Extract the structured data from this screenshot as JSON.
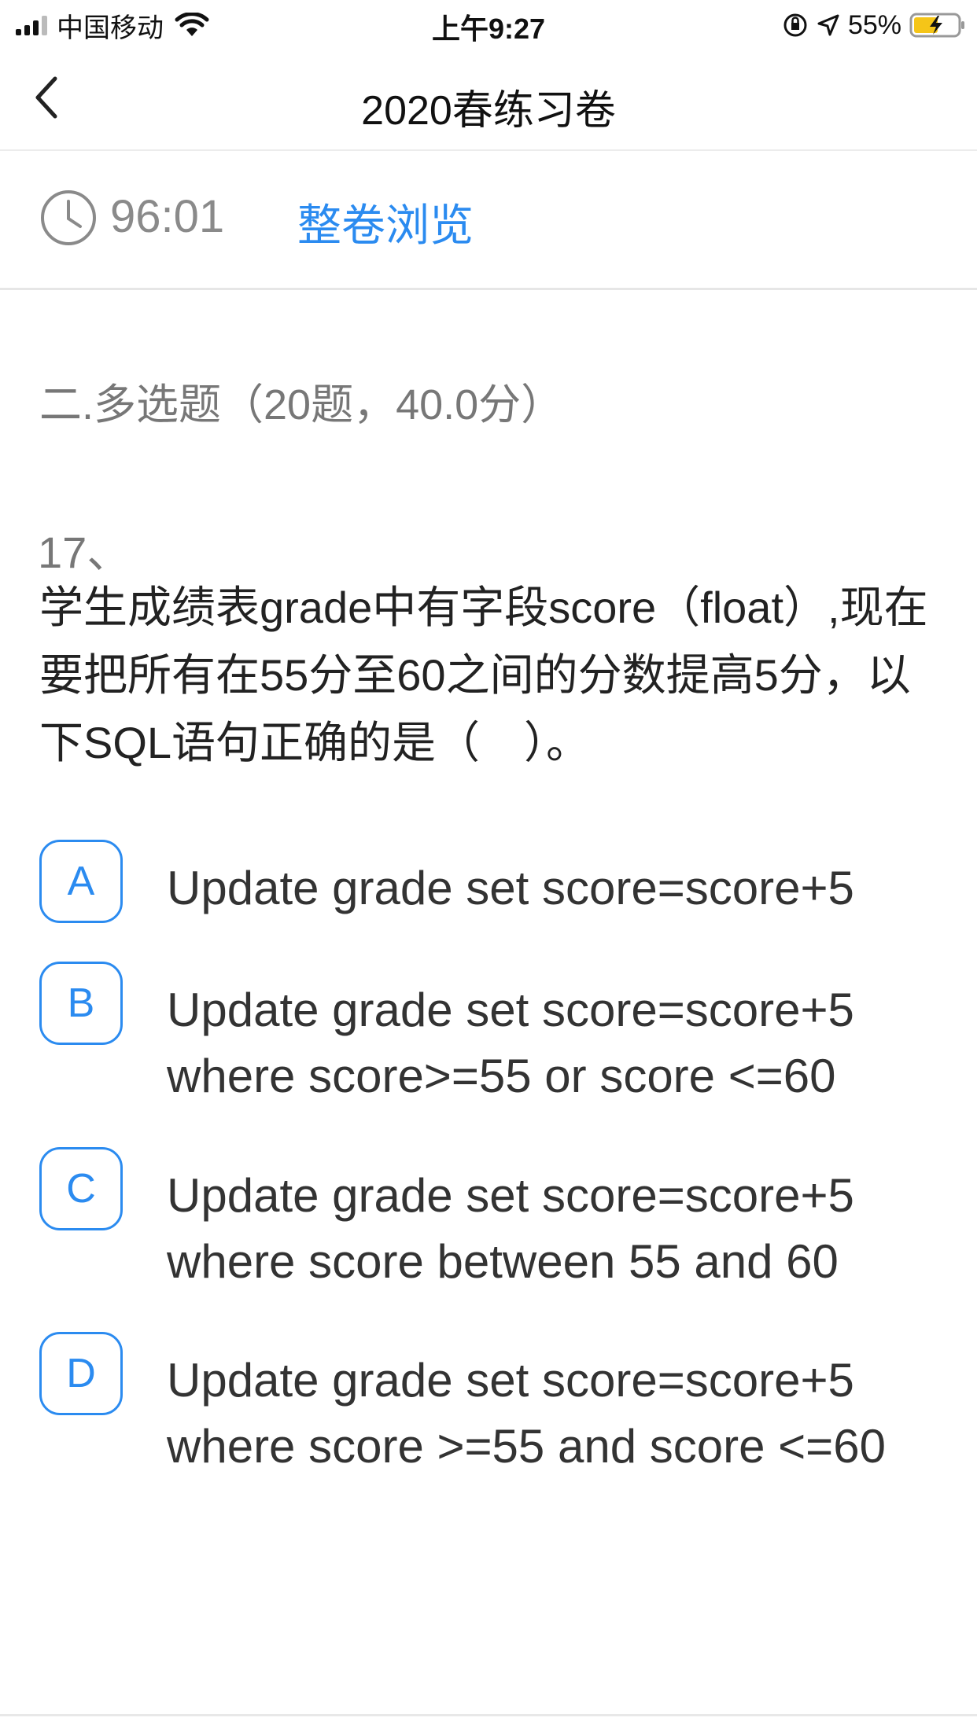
{
  "status_bar": {
    "carrier": "中国移动",
    "time": "上午9:27",
    "battery_percent": "55%"
  },
  "nav": {
    "title": "2020春练习卷"
  },
  "timer": {
    "value": "96:01",
    "overview_label": "整卷浏览"
  },
  "section": {
    "title": "二.多选题（20题，40.0分）"
  },
  "question": {
    "number": "17、",
    "text": "学生成绩表grade中有字段score（float）,现在要把所有在55分至60之间的分数提高5分，以下SQL语句正确的是（　）。",
    "options": [
      {
        "letter": "A",
        "text": "Update grade set score=score+5"
      },
      {
        "letter": "B",
        "text": "Update grade set score=score+5 where score>=55 or score <=60"
      },
      {
        "letter": "C",
        "text": "Update grade set score=score+5 where score between 55 and 60"
      },
      {
        "letter": "D",
        "text": "Update grade set score=score+5 where score >=55 and score <=60"
      }
    ]
  },
  "colors": {
    "accent": "#2b8bf0",
    "muted": "#8a8a8a",
    "text": "#222222"
  }
}
